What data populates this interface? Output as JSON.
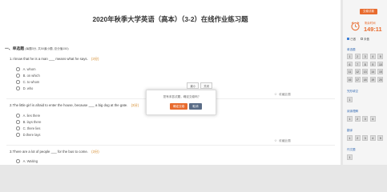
{
  "page": {
    "title": "2020年秋季大学英语（高本）（3-2）在线作业练习题"
  },
  "section": {
    "heading": "一、单选题",
    "sub": "(每题3分, 共50道小题, 总分值150)"
  },
  "questions": [
    {
      "stem": "1.I know that he is a man ___ means what he says.",
      "score": "(3分)",
      "options": [
        "A. whom",
        "B. on which",
        "C. to whom",
        "D. who"
      ]
    },
    {
      "stem": "2.The little girl is afraid to enter the house, because ___ a big dog at the gate.",
      "score": "(3分)",
      "options": [
        "A. lies there",
        "B. lays there",
        "C. there lies",
        "D.there lays"
      ]
    },
    {
      "stem": "3.There are a lot of people ___ for the bus to come.",
      "score": "(3分)",
      "options": [
        "A. Waiting"
      ]
    }
  ],
  "favorite_label": "收藏此题",
  "modal": {
    "top_buttons": [
      "最小",
      "关闭"
    ],
    "message": "您有未答试题，确定交卷吗？",
    "confirm": "确定交卷",
    "cancel": "取消"
  },
  "panel": {
    "submit_label": "交卷试卷",
    "timer_label": "剩余时间",
    "timer": "149:11",
    "legend_done": "已做",
    "legend_todo": "未做",
    "groups": [
      {
        "name": "单选题",
        "numbers": [
          "1",
          "2",
          "3",
          "4",
          "5",
          "6",
          "7",
          "8",
          "9",
          "10",
          "11",
          "12",
          "13",
          "14",
          "15",
          "16",
          "17",
          "18",
          "19",
          "20"
        ]
      },
      {
        "name": "完形填空",
        "numbers": [
          "1"
        ]
      },
      {
        "name": "阅读理解",
        "numbers": [
          "1",
          "2",
          "3",
          "4"
        ]
      },
      {
        "name": "翻译",
        "numbers": [
          "1",
          "2",
          "3",
          "4",
          "5"
        ]
      },
      {
        "name": "作文题",
        "numbers": [
          "1"
        ]
      }
    ]
  },
  "colors": {
    "accent": "#e86b2e",
    "secondary": "#5a6c86",
    "link": "#3b6fb5"
  }
}
